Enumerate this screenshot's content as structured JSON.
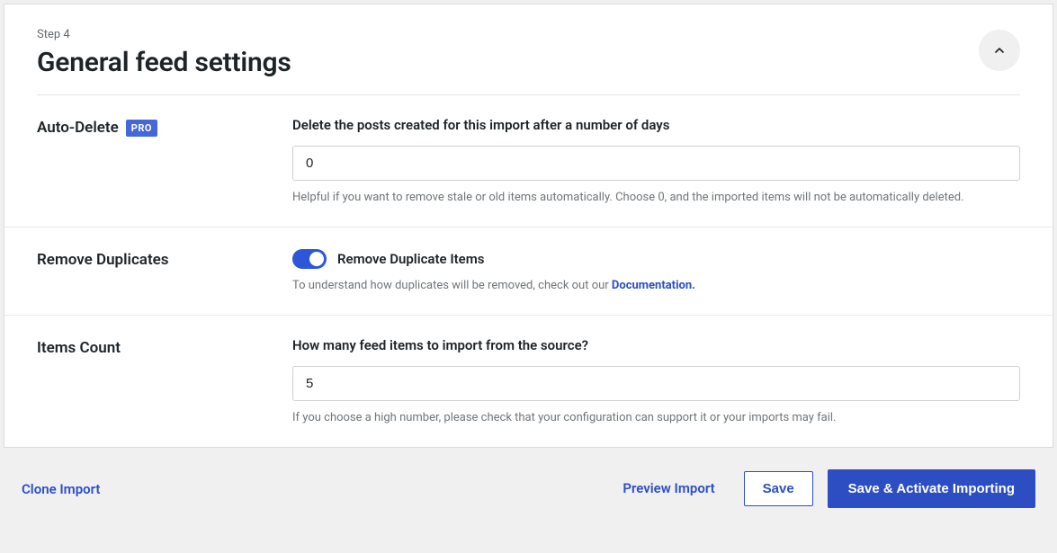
{
  "header": {
    "step_label": "Step 4",
    "title": "General feed settings"
  },
  "fields": {
    "auto_delete": {
      "label": "Auto-Delete",
      "pro_badge": "PRO",
      "description": "Delete the posts created for this import after a number of days",
      "value": "0",
      "help": "Helpful if you want to remove stale or old items automatically. Choose 0, and the imported items will not be automatically deleted."
    },
    "remove_duplicates": {
      "label": "Remove Duplicates",
      "toggle_label": "Remove Duplicate Items",
      "help_prefix": "To understand how duplicates will be removed, check out our ",
      "help_link": "Documentation."
    },
    "items_count": {
      "label": "Items Count",
      "description": "How many feed items to import from the source?",
      "value": "5",
      "help": "If you choose a high number, please check that your configuration can support it or your imports may fail."
    }
  },
  "footer": {
    "clone_import": "Clone Import",
    "preview_import": "Preview Import",
    "save": "Save",
    "save_activate": "Save & Activate Importing"
  }
}
